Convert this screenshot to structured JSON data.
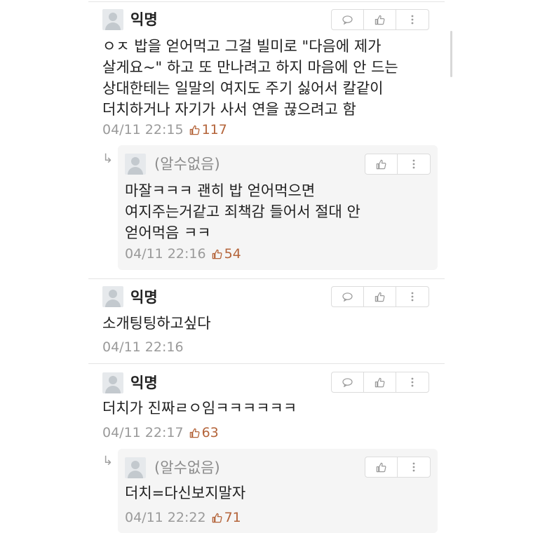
{
  "comments": [
    {
      "author": "익명",
      "text": "ㅇㅈ 밥을 얻어먹고 그걸 빌미로 \"다음에 제가\n살게요~\" 하고 또 만나려고 하지 마음에 안 드는\n상대한테는 일말의 여지도 주기 싫어서 칼같이\n더치하거나 자기가 사서 연을 끊으려고 함",
      "time": "04/11 22:15",
      "likes": "117",
      "reply": {
        "author": "(알수없음)",
        "text": "마잘ㅋㅋㅋ 괜히 밥 얻어먹으면\n여지주는거같고 죄책감 들어서 절대 안\n얻어먹음 ㅋㅋ",
        "time": "04/11 22:16",
        "likes": "54"
      }
    },
    {
      "author": "익명",
      "text": "소개팅팅하고싶다",
      "time": "04/11 22:16"
    },
    {
      "author": "익명",
      "text": "더치가 진짜ㄹㅇ임ㅋㅋㅋㅋㅋㅋ",
      "time": "04/11 22:17",
      "likes": "63",
      "reply": {
        "author": "(알수없음)",
        "text": "더치=다신보지말자",
        "time": "04/11 22:22",
        "likes": "71"
      }
    }
  ],
  "icons": {
    "comment": "speech-bubble-icon",
    "like": "thumbs-up-icon",
    "more": "vertical-dots-icon",
    "reply": "reply-arrow-icon"
  }
}
